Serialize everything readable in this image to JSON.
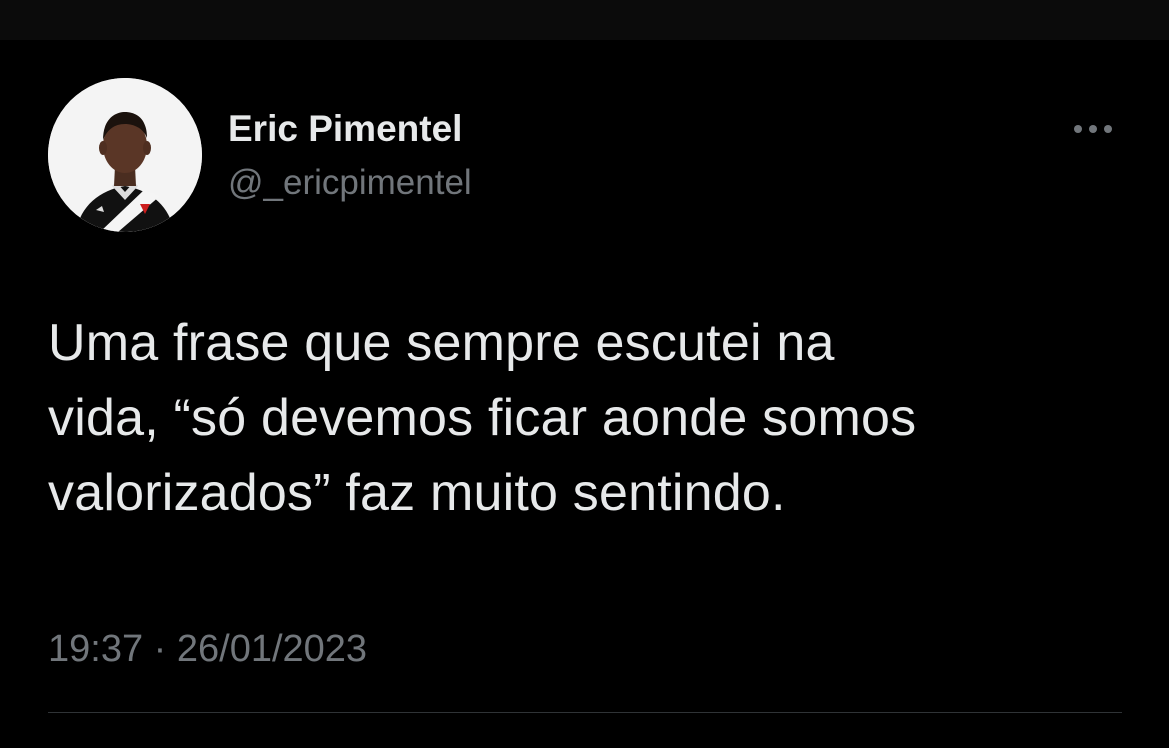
{
  "tweet": {
    "author": {
      "name": "Eric Pimentel",
      "handle": "@_ericpimentel"
    },
    "text": "Uma frase que sempre escutei na\nvida, “só devemos ficar aonde somos\nvalorizados” faz muito sentindo.",
    "time": "19:37",
    "separator": "·",
    "date": "26/01/2023"
  },
  "icons": {
    "more": "more-horizontal-icon",
    "avatar": "profile-photo"
  },
  "colors": {
    "background": "#000000",
    "primary_text": "#e7e9ea",
    "secondary_text": "#71767b",
    "divider": "#2f3336"
  }
}
